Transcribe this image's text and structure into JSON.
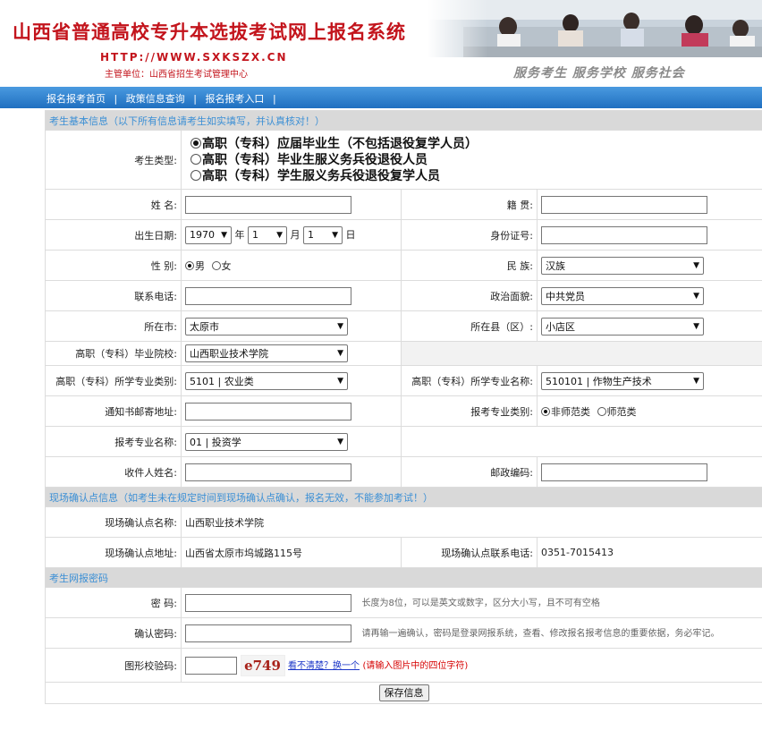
{
  "header": {
    "title": "山西省普通高校专升本选拔考试网上报名系统",
    "url": "HTTP://WWW.SXKSZX.CN",
    "owner": "主管单位：山西省招生考试管理中心",
    "slogan": "服务考生   服务学校   服务社会"
  },
  "nav": {
    "home": "报名报考首页",
    "sep1": "|",
    "policy": "政策信息查询",
    "sep2": "|",
    "entry": "报名报考入口",
    "sep3": "|"
  },
  "basic": {
    "header": "考生基本信息（以下所有信息请考生如实填写，并认真核对！）",
    "type_label": "考生类型:",
    "type_options": [
      "高职（专科）应届毕业生（不包括退役复学人员）",
      "高职（专科）毕业生服义务兵役退役人员",
      "高职（专科）学生服义务兵役退役复学人员"
    ],
    "name_label": "姓  名:",
    "origin_label": "籍  贯:",
    "birth_label": "出生日期:",
    "birth_year": "1970",
    "birth_month": "1",
    "birth_day": "1",
    "year_unit": "年",
    "month_unit": "月",
    "day_unit": "日",
    "id_label": "身份证号:",
    "gender_label": "性  别:",
    "gender_male": "男",
    "gender_female": "女",
    "ethnic_label": "民  族:",
    "ethnic_value": "汉族",
    "phone_label": "联系电话:",
    "political_label": "政治面貌:",
    "political_value": "中共党员",
    "city_label": "所在市:",
    "city_value": "太原市",
    "county_label": "所在县（区）:",
    "county_value": "小店区",
    "school_label": "高职（专科）毕业院校:",
    "school_value": "山西职业技术学院",
    "major_cat_label": "高职（专科）所学专业类别:",
    "major_cat_value": "5101 | 农业类",
    "major_name_label": "高职（专科）所学专业名称:",
    "major_name_value": "510101 | 作物生产技术",
    "address_label": "通知书邮寄地址:",
    "apply_type_label": "报考专业类别:",
    "apply_type_a": "非师范类",
    "apply_type_b": "师范类",
    "apply_major_label": "报考专业名称:",
    "apply_major_value": "01 | 投资学",
    "recipient_label": "收件人姓名:",
    "postcode_label": "邮政编码:"
  },
  "confirm": {
    "header": "现场确认点信息（如考生未在规定时间到现场确认点确认，报名无效，不能参加考试！）",
    "site_name_label": "现场确认点名称:",
    "site_name_value": "山西职业技术学院",
    "site_addr_label": "现场确认点地址:",
    "site_addr_value": "山西省太原市坞城路115号",
    "site_phone_label": "现场确认点联系电话:",
    "site_phone_value": "0351-7015413"
  },
  "password": {
    "header": "考生网报密码",
    "pwd_label": "密  码:",
    "pwd_hint": "长度为8位，可以是英文或数字，区分大小写，且不可有空格",
    "confirm_label": "确认密码:",
    "confirm_hint": "请再输一遍确认，密码是登录网报系统，查看、修改报名报考信息的重要依据，务必牢记。",
    "captcha_label": "图形校验码:",
    "captcha_text": "e749",
    "refresh_link": "看不清楚？换一个",
    "captcha_hint": "(请输入图片中的四位字符)",
    "save_button": "保存信息"
  }
}
